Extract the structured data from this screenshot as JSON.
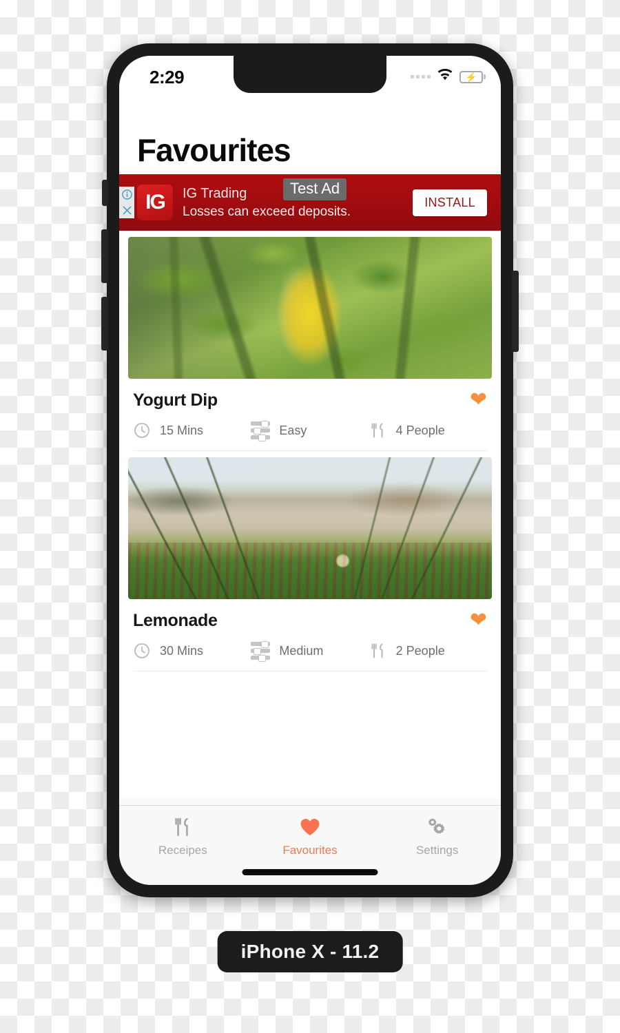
{
  "device": {
    "label": "iPhone X - 11.2"
  },
  "status_bar": {
    "time": "2:29",
    "signal_icon": "signal-dots-icon",
    "wifi_icon": "wifi-icon",
    "battery_icon": "battery-charging-icon"
  },
  "nav": {
    "title": "Favourites"
  },
  "ad": {
    "info_icon": "info-icon",
    "close_icon": "close-icon",
    "logo_text": "IG",
    "advertiser": "IG Trading",
    "disclaimer": "Losses can exceed deposits.",
    "badge": "Test Ad",
    "cta_label": "INSTALL",
    "background_color": "#a00c0f",
    "cta_text_color": "#9b1317"
  },
  "recipes": [
    {
      "title": "Yogurt Dip",
      "photo_alt": "citrus-foliage-photo",
      "favourite": true,
      "heart_icon": "heart-filled-icon",
      "meta": [
        {
          "icon": "clock-icon",
          "label": "15 Mins"
        },
        {
          "icon": "difficulty-bars-icon",
          "label": "Easy"
        },
        {
          "icon": "fork-knife-icon",
          "label": "4 People"
        }
      ]
    },
    {
      "title": "Lemonade",
      "photo_alt": "beach-dune-flower-photo",
      "favourite": true,
      "heart_icon": "heart-filled-icon",
      "meta": [
        {
          "icon": "clock-icon",
          "label": "30 Mins"
        },
        {
          "icon": "difficulty-bars-icon",
          "label": "Medium"
        },
        {
          "icon": "fork-knife-icon",
          "label": "2 People"
        }
      ]
    }
  ],
  "tabbar": {
    "active_color": "#f5764f",
    "inactive_color": "#a6a6a6",
    "items": [
      {
        "label": "Receipes",
        "icon": "fork-knife-icon",
        "active": false
      },
      {
        "label": "Favourites",
        "icon": "heart-filled-icon",
        "active": true
      },
      {
        "label": "Settings",
        "icon": "gears-icon",
        "active": false
      }
    ]
  }
}
